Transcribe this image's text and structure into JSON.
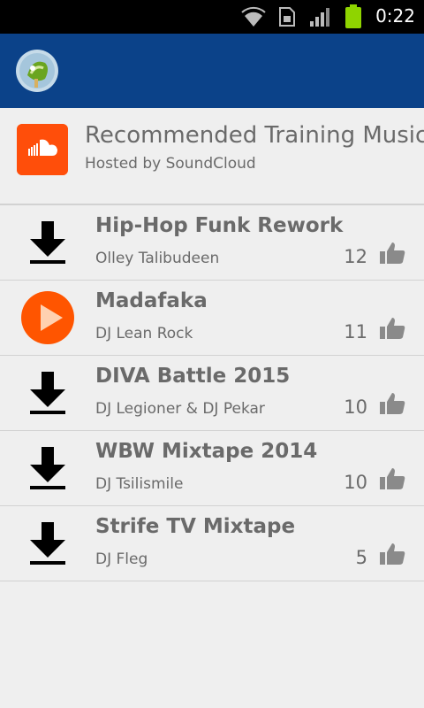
{
  "status_bar": {
    "time": "0:22"
  },
  "header": {
    "title": "Recommended Training Music",
    "subtitle": "Hosted by SoundCloud"
  },
  "tracks": [
    {
      "title": "Hip-Hop Funk Rework",
      "artist": "Olley Talibudeen",
      "likes": "12",
      "icon": "download-icon"
    },
    {
      "title": "Madafaka",
      "artist": "DJ Lean Rock",
      "likes": "11",
      "icon": "play-icon"
    },
    {
      "title": "DIVA Battle 2015",
      "artist": "DJ Legioner & DJ Pekar",
      "likes": "10",
      "icon": "download-icon"
    },
    {
      "title": "WBW Mixtape 2014",
      "artist": "DJ Tsilismile",
      "likes": "10",
      "icon": "download-icon"
    },
    {
      "title": "Strife TV Mixtape",
      "artist": "DJ Fleg",
      "likes": "5",
      "icon": "download-icon"
    }
  ],
  "colors": {
    "app_bar": "#0b4289",
    "soundcloud": "#ff5500",
    "text": "#6a6a6a"
  }
}
